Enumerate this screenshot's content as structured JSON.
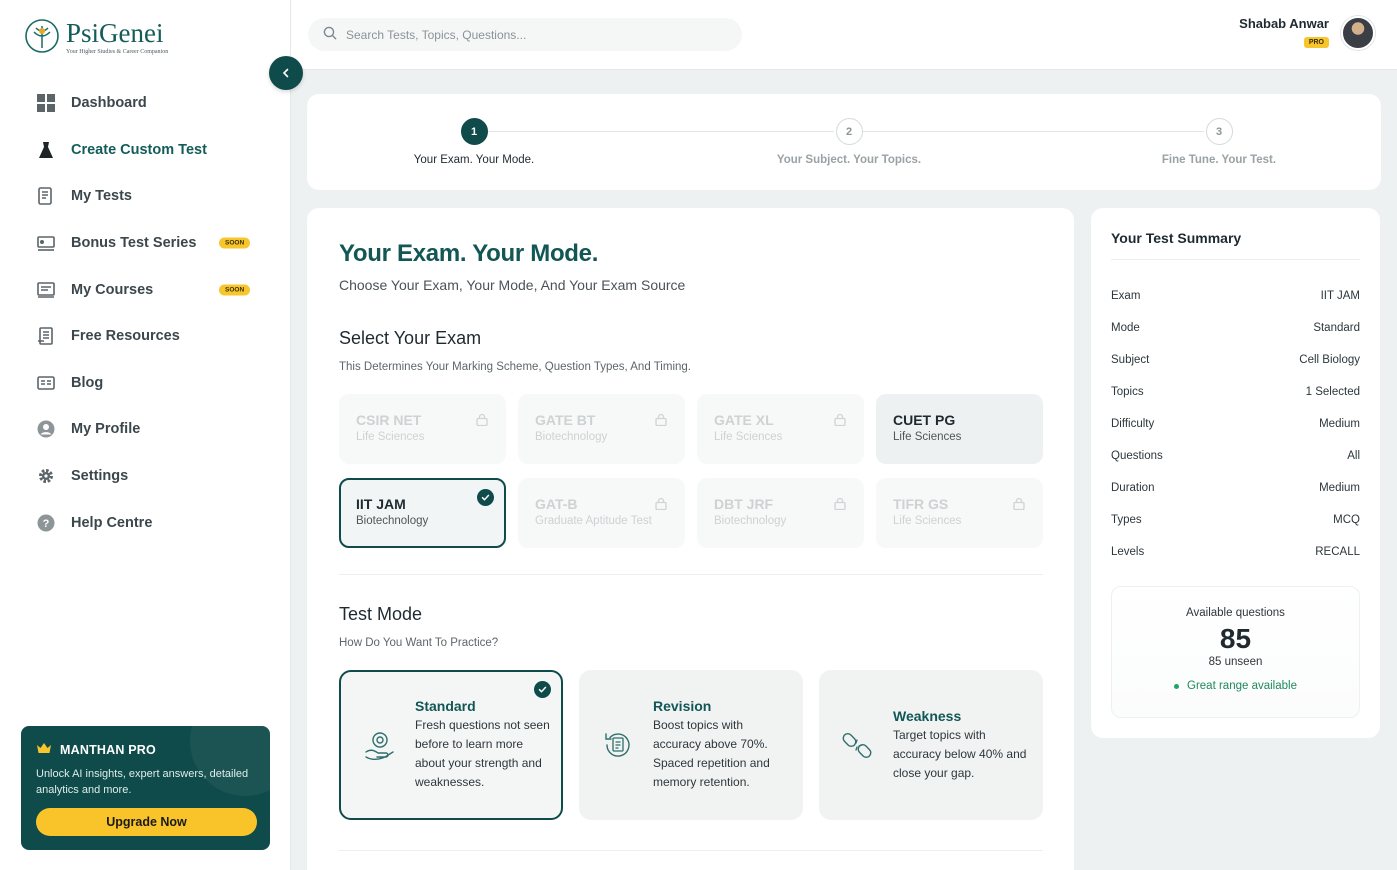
{
  "brand": {
    "name": "PsiGenei",
    "tagline": "Your Higher Studies & Career Companion"
  },
  "sidebar": {
    "items": [
      {
        "label": "Dashboard",
        "icon": "dashboard-icon"
      },
      {
        "label": "Create Custom Test",
        "icon": "create-test-icon",
        "active": true
      },
      {
        "label": "My Tests",
        "icon": "my-tests-icon"
      },
      {
        "label": "Bonus Test Series",
        "icon": "bonus-series-icon",
        "badge": "SOON"
      },
      {
        "label": "My Courses",
        "icon": "courses-icon",
        "badge": "SOON"
      },
      {
        "label": "Free Resources",
        "icon": "resources-icon"
      },
      {
        "label": "Blog",
        "icon": "blog-icon"
      },
      {
        "label": "My Profile",
        "icon": "profile-icon"
      },
      {
        "label": "Settings",
        "icon": "gear-icon"
      },
      {
        "label": "Help Centre",
        "icon": "help-icon"
      }
    ],
    "promo": {
      "title": "MANTHAN PRO",
      "text": "Unlock AI insights, expert answers, detailed analytics and more.",
      "button": "Upgrade Now"
    }
  },
  "topbar": {
    "search_placeholder": "Search Tests, Topics, Questions...",
    "user_name": "Shabab Anwar",
    "user_badge": "PRO"
  },
  "stepper": [
    {
      "number": "1",
      "label": "Your Exam. Your Mode.",
      "active": true
    },
    {
      "number": "2",
      "label": "Your Subject. Your Topics."
    },
    {
      "number": "3",
      "label": "Fine Tune. Your Test."
    }
  ],
  "main": {
    "title": "Your Exam. Your Mode.",
    "subtitle": "Choose Your Exam, Your Mode, And Your Exam Source",
    "exam_heading": "Select Your Exam",
    "exam_desc": "This Determines Your Marking Scheme, Question Types, And Timing.",
    "exams": [
      {
        "name": "CSIR NET",
        "category": "Life Sciences",
        "state": "locked"
      },
      {
        "name": "GATE BT",
        "category": "Biotechnology",
        "state": "locked"
      },
      {
        "name": "GATE XL",
        "category": "Life Sciences",
        "state": "locked"
      },
      {
        "name": "CUET PG",
        "category": "Life Sciences",
        "state": "available"
      },
      {
        "name": "IIT JAM",
        "category": "Biotechnology",
        "state": "selected"
      },
      {
        "name": "GAT-B",
        "category": "Graduate Aptitude Test",
        "state": "locked"
      },
      {
        "name": "DBT JRF",
        "category": "Biotechnology",
        "state": "locked"
      },
      {
        "name": "TIFR GS",
        "category": "Life Sciences",
        "state": "locked"
      }
    ],
    "mode_heading": "Test Mode",
    "mode_desc": "How Do You Want To Practice?",
    "modes": [
      {
        "title": "Standard",
        "text": "Fresh questions not seen before to learn more about your strength and weaknesses.",
        "icon": "standard-mode-icon",
        "selected": true
      },
      {
        "title": "Revision",
        "text": "Boost topics with accuracy above 70%. Spaced repetition and memory retention.",
        "icon": "revision-mode-icon"
      },
      {
        "title": "Weakness",
        "text": "Target topics with accuracy below 40% and close your gap.",
        "icon": "weakness-mode-icon"
      }
    ]
  },
  "summary": {
    "title": "Your Test Summary",
    "rows": [
      {
        "key": "Exam",
        "value": "IIT JAM"
      },
      {
        "key": "Mode",
        "value": "Standard"
      },
      {
        "key": "Subject",
        "value": "Cell Biology"
      },
      {
        "key": "Topics",
        "value": "1 Selected"
      },
      {
        "key": "Difficulty",
        "value": "Medium"
      },
      {
        "key": "Questions",
        "value": "All"
      },
      {
        "key": "Duration",
        "value": "Medium"
      },
      {
        "key": "Types",
        "value": "MCQ"
      },
      {
        "key": "Levels",
        "value": "RECALL"
      }
    ],
    "available_label": "Available questions",
    "available_count": "85",
    "unseen": "85 unseen",
    "range_note": "Great range available"
  },
  "colors": {
    "primary": "#0f4b4a",
    "accent": "#f7c52c",
    "success": "#22a36a"
  }
}
